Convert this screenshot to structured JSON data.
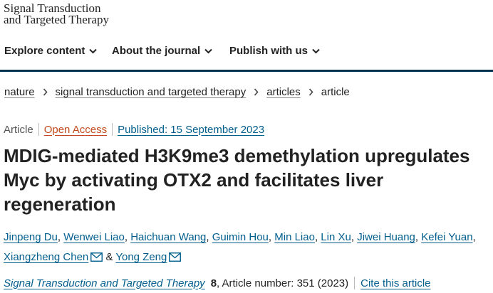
{
  "site": {
    "logo_line1": "Signal Transduction",
    "logo_line2": "and Targeted Therapy"
  },
  "nav": {
    "items": [
      {
        "label": "Explore content",
        "icon": "chevron-down-icon"
      },
      {
        "label": "About the journal",
        "icon": "chevron-down-icon"
      },
      {
        "label": "Publish with us",
        "icon": "chevron-down-icon"
      }
    ]
  },
  "breadcrumb": {
    "items": [
      "nature",
      "signal transduction and targeted therapy",
      "articles"
    ],
    "current": "article"
  },
  "meta": {
    "type": "Article",
    "access": "Open Access",
    "published": "Published: 15 September 2023"
  },
  "article": {
    "title": "MDIG-mediated H3K9me3 demethylation upregulates Myc by activating OTX2 and facilitates liver regeneration"
  },
  "authors": [
    "Jinpeng Du",
    "Wenwei Liao",
    "Haichuan Wang",
    "Guimin Hou",
    "Min Liao",
    "Lin Xu",
    "Jiwei Huang",
    "Kefei Yuan",
    "Xiangzheng Chen",
    "Yong Zeng"
  ],
  "author_joiner": "&",
  "citation": {
    "journal": "Signal Transduction and Targeted Therapy",
    "volume": "8",
    "article_number": ", Article number: 351 (2023)",
    "cite_label": "Cite this article"
  },
  "colors": {
    "link": "#025e8d",
    "open_access": "#c34a1e",
    "accent_bar": "#01324b"
  }
}
